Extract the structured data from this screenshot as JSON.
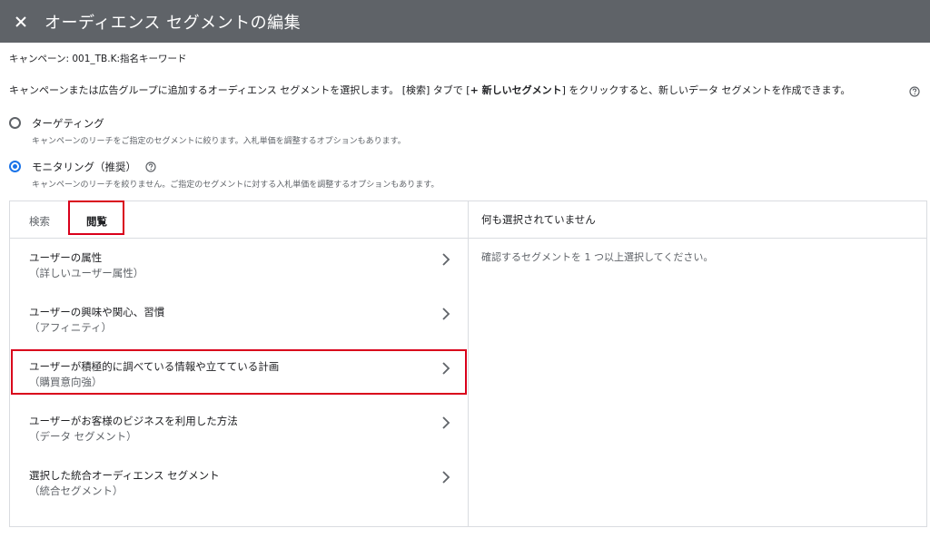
{
  "header": {
    "title": "オーディエンス セグメントの編集",
    "close_icon": "close-icon"
  },
  "campaign_line": "キャンペーン: 001_TB.K:指名キーワード",
  "description": {
    "part1": "キャンペーンまたは広告グループに追加するオーディエンス セグメントを選択します。 [検索] タブで [",
    "bold": "+ 新しいセグメント",
    "part2": "] をクリックすると、新しいデータ セグメントを作成できます。",
    "help_icon": "help-icon"
  },
  "options": [
    {
      "label": "ターゲティング",
      "sublabel": "キャンペーンのリーチをご指定のセグメントに絞ります。入札単価を調整するオプションもあります。",
      "selected": false
    },
    {
      "label": "モニタリング（推奨）",
      "sublabel": "キャンペーンのリーチを絞りません。ご指定のセグメントに対する入札単価を調整するオプションもあります。",
      "selected": true,
      "help_icon": "help-icon"
    }
  ],
  "tabs": {
    "search": "検索",
    "browse": "閲覧",
    "active": "browse"
  },
  "categories": [
    {
      "title": "ユーザーの属性",
      "subtitle": "（詳しいユーザー属性）"
    },
    {
      "title": "ユーザーの興味や関心、習慣",
      "subtitle": "（アフィニティ）"
    },
    {
      "title": "ユーザーが積極的に調べている情報や立てている計画",
      "subtitle": "（購買意向強）"
    },
    {
      "title": "ユーザーがお客様のビジネスを利用した方法",
      "subtitle": "（データ セグメント）"
    },
    {
      "title": "選択した統合オーディエンス セグメント",
      "subtitle": "（統合セグメント）"
    }
  ],
  "selection": {
    "header": "何も選択されていません",
    "empty_message": "確認するセグメントを 1 つ以上選択してください。"
  },
  "colors": {
    "header_bg": "#5f6368",
    "accent": "#1a73e8",
    "highlight": "#d9001b"
  }
}
